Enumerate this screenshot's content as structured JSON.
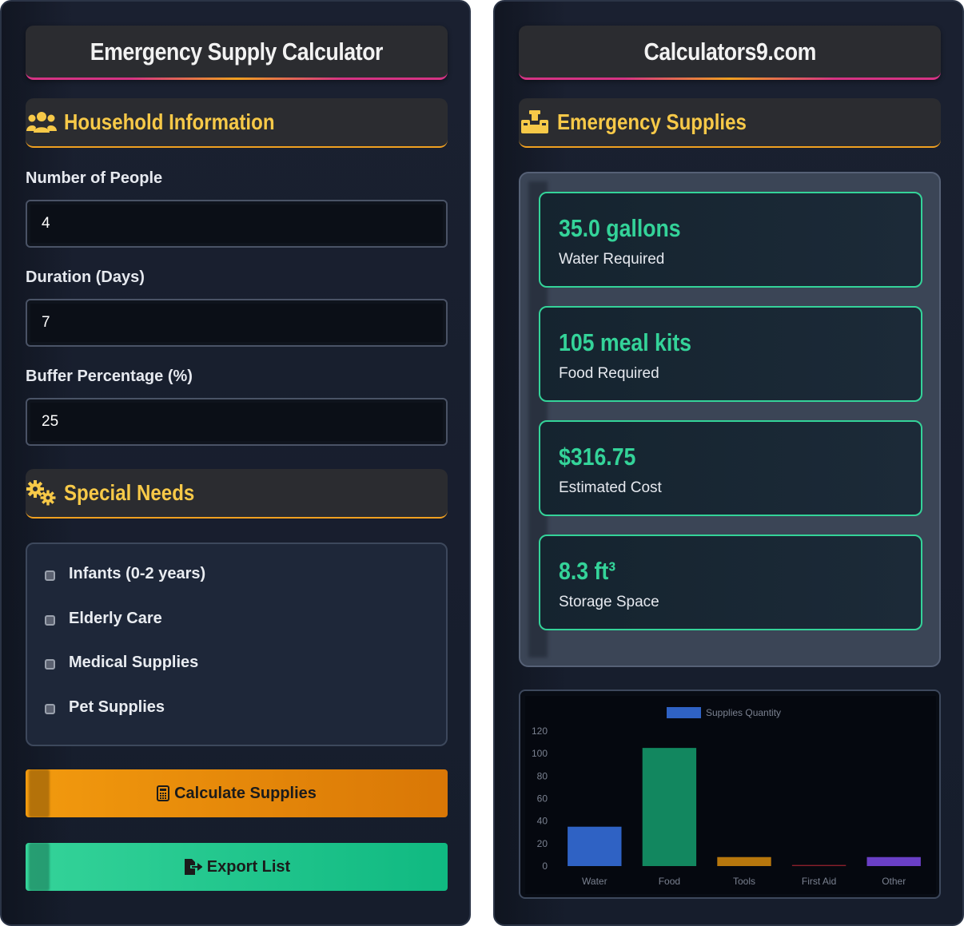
{
  "left": {
    "title": "Emergency Supply Calculator",
    "household": {
      "heading": "Household Information",
      "icon": "users-icon",
      "people_label": "Number of People",
      "people_value": "4",
      "duration_label": "Duration (Days)",
      "duration_value": "7",
      "buffer_label": "Buffer Percentage (%)",
      "buffer_value": "25"
    },
    "special": {
      "heading": "Special Needs",
      "icon": "gears-icon",
      "items": [
        "Infants (0-2 years)",
        "Elderly Care",
        "Medical Supplies",
        "Pet Supplies"
      ]
    },
    "calculate_label": "Calculate Supplies",
    "export_label": "Export List"
  },
  "right": {
    "title": "Calculators9.com",
    "supplies_heading": "Emergency Supplies",
    "supplies_icon": "supplies-icon",
    "cards": [
      {
        "value": "35.0 gallons",
        "label": "Water Required"
      },
      {
        "value": "105 meal kits",
        "label": "Food Required"
      },
      {
        "value": "$316.75",
        "label": "Estimated Cost"
      },
      {
        "value": "8.3 ft³",
        "label": "Storage Space"
      }
    ]
  },
  "colors": {
    "accent_green": "#34d399",
    "accent_gold": "#f7c948",
    "accent_orange": "#f29a0e",
    "accent_pink": "#d63384"
  },
  "chart_data": {
    "type": "bar",
    "categories": [
      "Water",
      "Food",
      "Tools",
      "First Aid",
      "Other"
    ],
    "series": [
      {
        "name": "Supplies Quantity",
        "values": [
          35,
          105,
          8,
          1,
          8
        ]
      }
    ],
    "bar_colors": [
      "#2f62c4",
      "#12875f",
      "#b7770d",
      "#8a1f2a",
      "#6a3fc6"
    ],
    "legend_color": "#2f62c4",
    "ylim": [
      0,
      120
    ],
    "yticks": [
      0,
      20,
      40,
      60,
      80,
      100,
      120
    ],
    "legend": "top"
  }
}
